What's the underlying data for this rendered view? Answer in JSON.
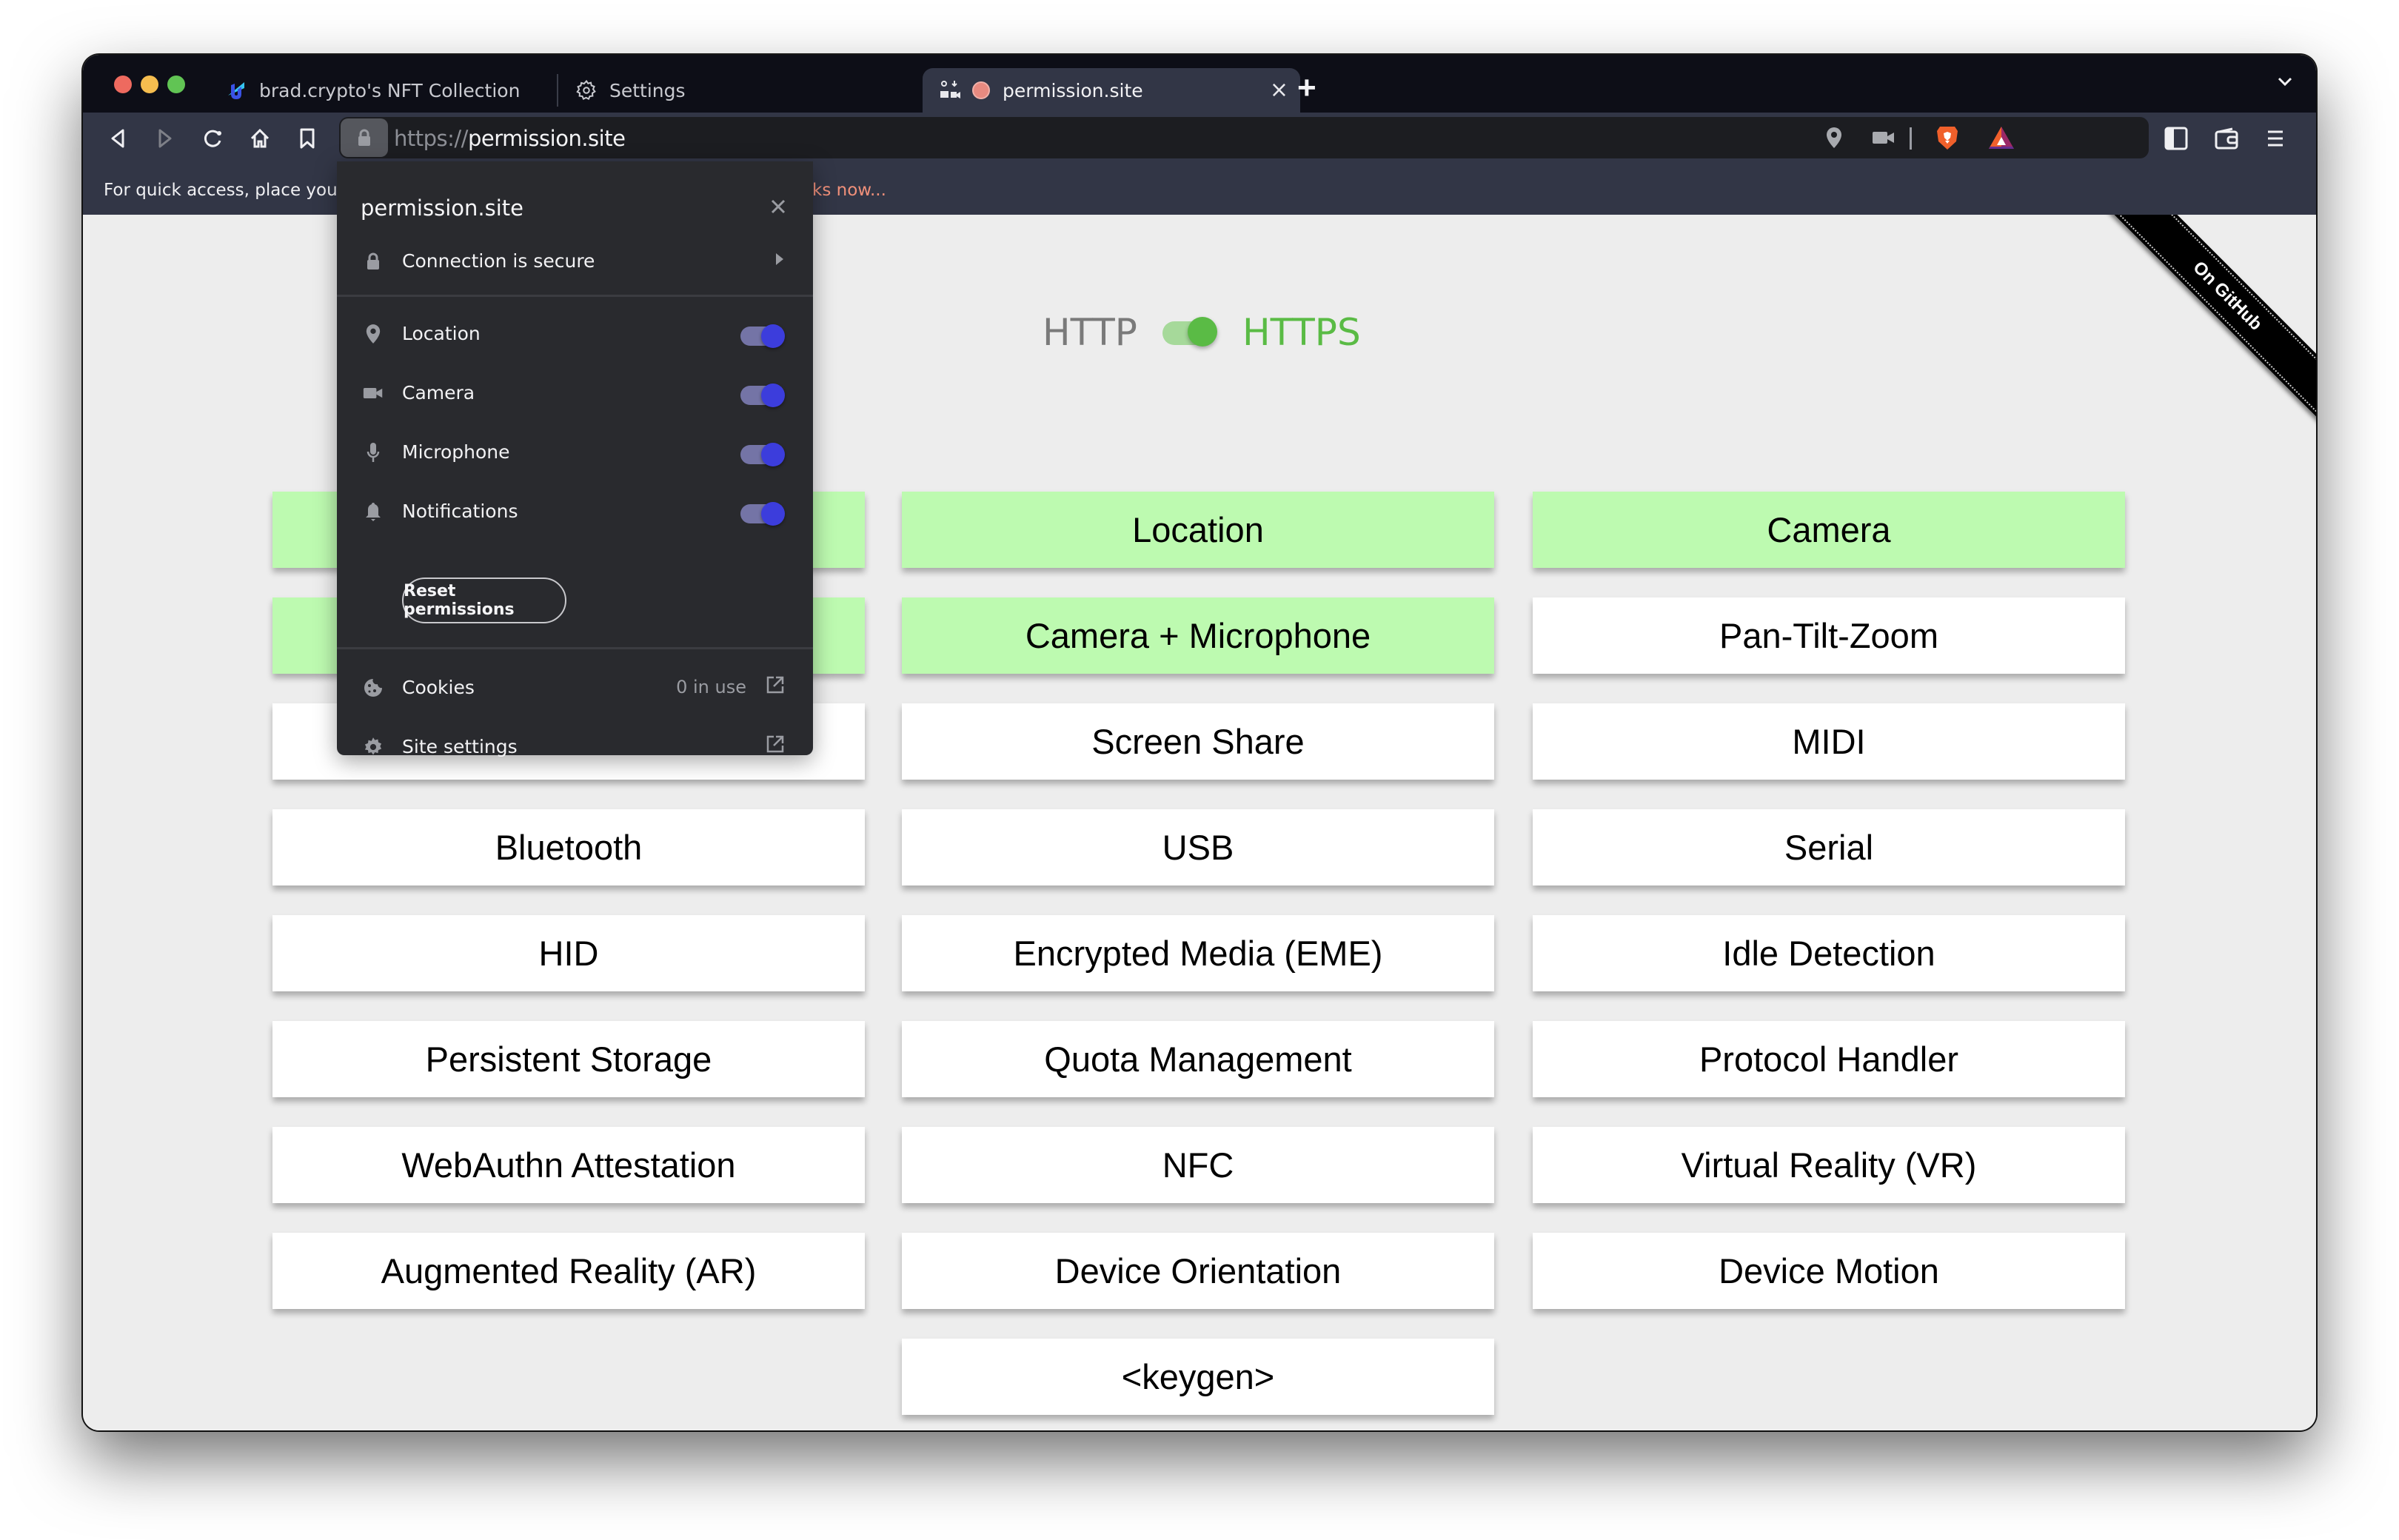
{
  "window": {
    "traffic_lights": [
      "close",
      "minimize",
      "zoom"
    ]
  },
  "tabs": [
    {
      "label": "brad.crypto's NFT Collection",
      "icon": "unstoppable-domains-icon",
      "active": false
    },
    {
      "label": "Settings",
      "icon": "gear-icon",
      "active": false
    },
    {
      "label": "permission.site",
      "icon": "recording-dot-icon",
      "indicator_icon": "location-camera-mic-indicator-icon",
      "active": true,
      "close_label": "×"
    }
  ],
  "new_tab_label": "+",
  "toolbar": {
    "url_scheme": "https://",
    "url_host": "permission.site",
    "right_icons": [
      "location-icon",
      "camera-icon",
      "brave-shields-icon",
      "brave-rewards-icon",
      "sidebar-icon",
      "wallet-icon",
      "menu-icon"
    ]
  },
  "bookmarks_bar": {
    "text_visible_left": "For quick access, place you",
    "link_visible_right": "ks now..."
  },
  "page": {
    "protocol_left": "HTTP",
    "protocol_right": "HTTPS",
    "protocol_https_enabled": true,
    "ribbon": "On GitHub",
    "colors": {
      "granted": "#bdfab0",
      "default": "#ffffff",
      "https_green": "#5abb45"
    },
    "buttons": [
      {
        "label": "",
        "granted": true
      },
      {
        "label": "Location",
        "granted": true
      },
      {
        "label": "Camera",
        "granted": true
      },
      {
        "label": "",
        "granted": true
      },
      {
        "label": "Camera + Microphone",
        "granted": true
      },
      {
        "label": "Pan-Tilt-Zoom",
        "granted": false
      },
      {
        "label": "",
        "granted": false
      },
      {
        "label": "Screen Share",
        "granted": false
      },
      {
        "label": "MIDI",
        "granted": false
      },
      {
        "label": "Bluetooth",
        "granted": false
      },
      {
        "label": "USB",
        "granted": false
      },
      {
        "label": "Serial",
        "granted": false
      },
      {
        "label": "HID",
        "granted": false
      },
      {
        "label": "Encrypted Media (EME)",
        "granted": false
      },
      {
        "label": "Idle Detection",
        "granted": false
      },
      {
        "label": "Persistent Storage",
        "granted": false
      },
      {
        "label": "Quota Management",
        "granted": false
      },
      {
        "label": "Protocol Handler",
        "granted": false
      },
      {
        "label": "WebAuthn Attestation",
        "granted": false
      },
      {
        "label": "NFC",
        "granted": false
      },
      {
        "label": "Virtual Reality (VR)",
        "granted": false
      },
      {
        "label": "Augmented Reality (AR)",
        "granted": false
      },
      {
        "label": "Device Orientation",
        "granted": false
      },
      {
        "label": "Device Motion",
        "granted": false
      },
      {
        "label": "<keygen>",
        "granted": false
      }
    ]
  },
  "popup": {
    "title": "permission.site",
    "connection": "Connection is secure",
    "permissions": [
      {
        "label": "Location",
        "icon": "location-icon",
        "enabled": true
      },
      {
        "label": "Camera",
        "icon": "camera-icon",
        "enabled": true
      },
      {
        "label": "Microphone",
        "icon": "microphone-icon",
        "enabled": true
      },
      {
        "label": "Notifications",
        "icon": "bell-icon",
        "enabled": true
      }
    ],
    "reset_label": "Reset permissions",
    "cookies_label": "Cookies",
    "cookies_value": "0 in use",
    "site_settings_label": "Site settings",
    "toggle_color": "#3c3ddc"
  }
}
